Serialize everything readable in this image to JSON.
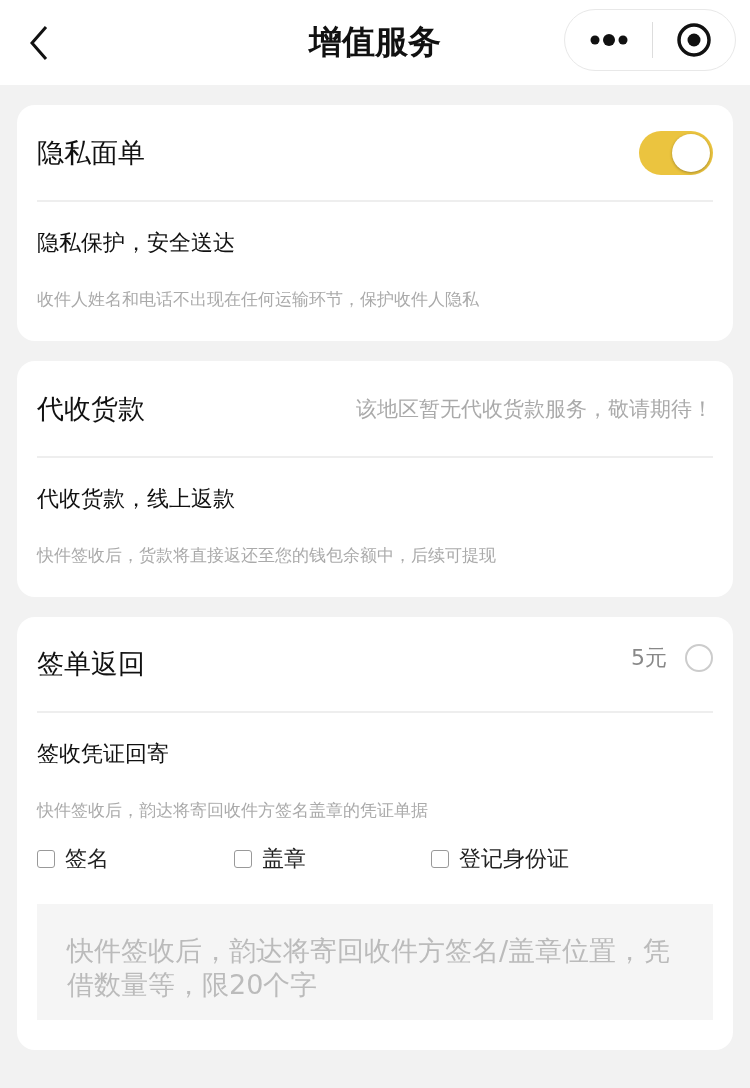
{
  "header": {
    "title": "增值服务"
  },
  "cards": [
    {
      "kind": "toggle",
      "title": "隐私面单",
      "on": true,
      "subtitle": "隐私保护，安全送达",
      "description": "收件人姓名和电话不出现在任何运输环节，保护收件人隐私"
    },
    {
      "kind": "notice",
      "title": "代收货款",
      "notice": "该地区暂无代收货款服务，敬请期待！",
      "subtitle": "代收货款，线上返款",
      "description": "快件签收后，货款将直接返还至您的钱包余额中，后续可提现"
    },
    {
      "kind": "radio",
      "title": "签单返回",
      "price": "5元",
      "selected": false,
      "subtitle": "签收凭证回寄",
      "description": "快件签收后，韵达将寄回收件方签名盖章的凭证单据",
      "options": [
        {
          "label": "签名",
          "checked": false
        },
        {
          "label": "盖章",
          "checked": false
        },
        {
          "label": "登记身份证",
          "checked": false
        }
      ],
      "placeholder": "快件签收后，韵达将寄回收件方签名/盖章位置，凭借数量等，限20个字"
    }
  ]
}
